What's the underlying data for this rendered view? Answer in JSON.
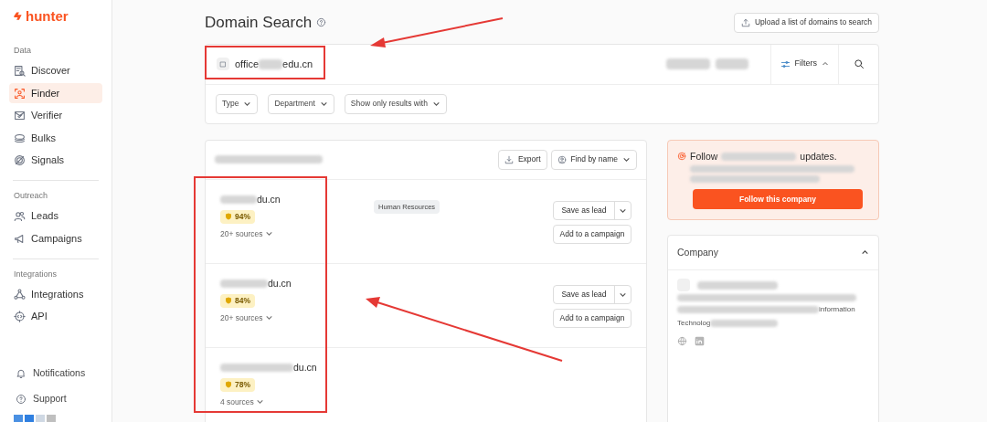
{
  "sidebar": {
    "logo": "hunter",
    "sections": [
      {
        "title": "Data",
        "items": [
          {
            "label": "Discover",
            "selected": false
          },
          {
            "label": "Finder",
            "selected": true
          },
          {
            "label": "Verifier",
            "selected": false
          },
          {
            "label": "Bulks",
            "selected": false
          },
          {
            "label": "Signals",
            "selected": false
          }
        ]
      },
      {
        "title": "Outreach",
        "items": [
          {
            "label": "Leads",
            "selected": false
          },
          {
            "label": "Campaigns",
            "selected": false
          }
        ]
      },
      {
        "title": "Integrations",
        "items": [
          {
            "label": "Integrations",
            "selected": false
          },
          {
            "label": "API",
            "selected": false
          }
        ]
      }
    ],
    "bottom_items": [
      {
        "label": "Notifications"
      },
      {
        "label": "Support"
      }
    ]
  },
  "header": {
    "title": "Domain Search",
    "upload_button": "Upload a list of domains to search"
  },
  "search": {
    "value_start": "office",
    "value_end": "edu.cn",
    "filters_button": "Filters",
    "filters": [
      "Type",
      "Department",
      "Show only results with"
    ]
  },
  "results": {
    "export_button": "Export",
    "find_button": "Find by name",
    "rows": [
      {
        "email_end": "du.cn",
        "confidence": "94%",
        "sources": "20+ sources",
        "department": "Human Resources",
        "actions": [
          "Save as lead",
          "Add to a campaign"
        ]
      },
      {
        "email_end": "du.cn",
        "confidence": "84%",
        "sources": "20+ sources",
        "actions": [
          "Save as lead",
          "Add to a campaign"
        ]
      },
      {
        "email_end": "du.cn",
        "confidence": "78%",
        "sources": "4 sources"
      }
    ]
  },
  "follow": {
    "title_start": "Follow",
    "title_end": "updates.",
    "button": "Follow this company"
  },
  "company": {
    "title": "Company",
    "expanded": true,
    "line_end": "information",
    "line_start": "Technolog"
  }
}
